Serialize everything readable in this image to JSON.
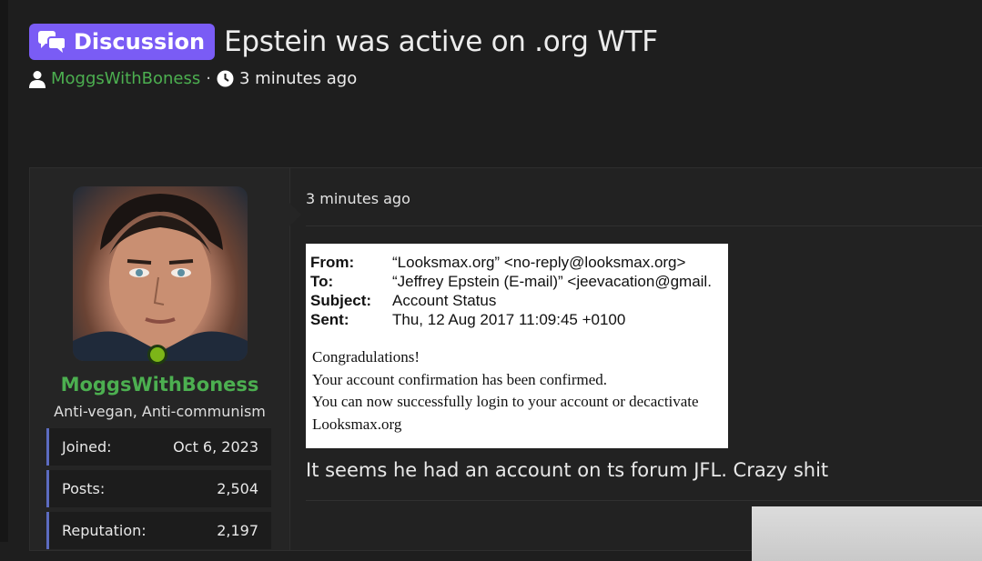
{
  "thread": {
    "prefix": "Discussion",
    "title": "Epstein was active on .org WTF",
    "author": "MoggsWithBoness",
    "separator": "·",
    "time_ago": "3 minutes ago"
  },
  "post": {
    "user": {
      "name": "MoggsWithBoness",
      "title": "Anti-vegan, Anti-communism",
      "online": true,
      "stats": [
        {
          "label": "Joined:",
          "value": "Oct 6, 2023"
        },
        {
          "label": "Posts:",
          "value": "2,504"
        },
        {
          "label": "Reputation:",
          "value": "2,197"
        }
      ]
    },
    "time": "3 minutes ago",
    "attachment": {
      "headers": [
        {
          "key": "From:",
          "value": "“Looksmax.org” <no-reply@looksmax.org>"
        },
        {
          "key": "To:",
          "value": "“Jeffrey Epstein (E-mail)” <jeevacation@gmail."
        },
        {
          "key": "Subject:",
          "value": "Account Status"
        },
        {
          "key": "Sent:",
          "value": "Thu, 12 Aug 2017 11:09:45 +0100"
        }
      ],
      "body": [
        "Congradulations!",
        "Your account confirmation has been confirmed.",
        "You can now successfully login to your account or decactivate",
        "Looksmax.org"
      ]
    },
    "text": "It seems he had an account on ts forum JFL. Crazy shit"
  },
  "colors": {
    "badge": "#7a5cf5",
    "username": "#4caf50",
    "stat_accent": "#5c6bc0",
    "online": "#7cb518"
  },
  "icons": [
    "comments-icon",
    "user-icon",
    "clock-icon"
  ]
}
